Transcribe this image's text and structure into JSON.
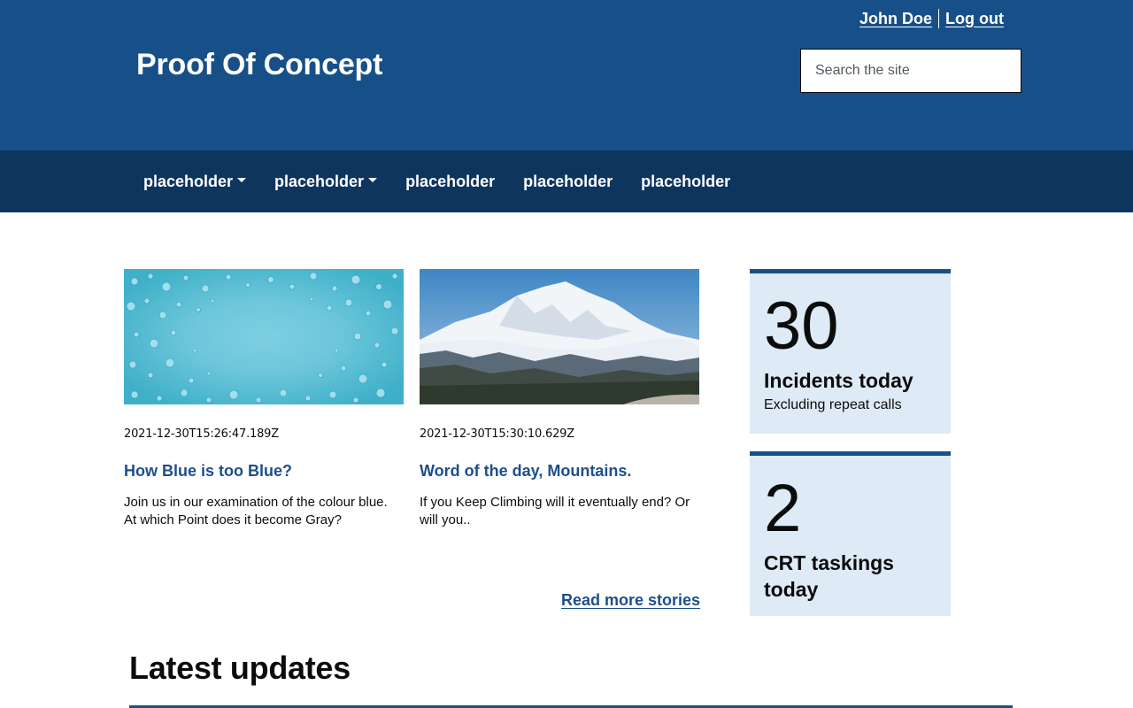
{
  "header": {
    "site_title": "Proof Of Concept",
    "user_name": "John Doe",
    "logout_label": "Log out",
    "search_placeholder": "Search the site"
  },
  "nav": {
    "items": [
      {
        "label": "placeholder",
        "has_dropdown": true
      },
      {
        "label": "placeholder",
        "has_dropdown": true
      },
      {
        "label": "placeholder",
        "has_dropdown": false
      },
      {
        "label": "placeholder",
        "has_dropdown": false
      },
      {
        "label": "placeholder",
        "has_dropdown": false
      }
    ]
  },
  "stories": [
    {
      "image": "water-droplets",
      "date": "2021-12-30T15:26:47.189Z",
      "title": "How Blue is too Blue?",
      "summary": "Join us in our examination of the colour blue. At which Point does it become Gray?"
    },
    {
      "image": "snowy-mountain",
      "date": "2021-12-30T15:30:10.629Z",
      "title": "Word of the day, Mountains.",
      "summary": "If you Keep Climbing will it eventually end? Or will you.."
    }
  ],
  "read_more_label": "Read more stories",
  "stats": [
    {
      "value": "30",
      "label": "Incidents today",
      "sublabel": "Excluding repeat calls"
    },
    {
      "value": "2",
      "label": "CRT taskings today",
      "sublabel": ""
    }
  ],
  "latest_updates": {
    "title": "Latest updates"
  },
  "colors": {
    "header_bg": "#174f89",
    "nav_bg": "#0e355e",
    "link": "#1d4f8a",
    "stat_bg": "#deeaf5"
  }
}
